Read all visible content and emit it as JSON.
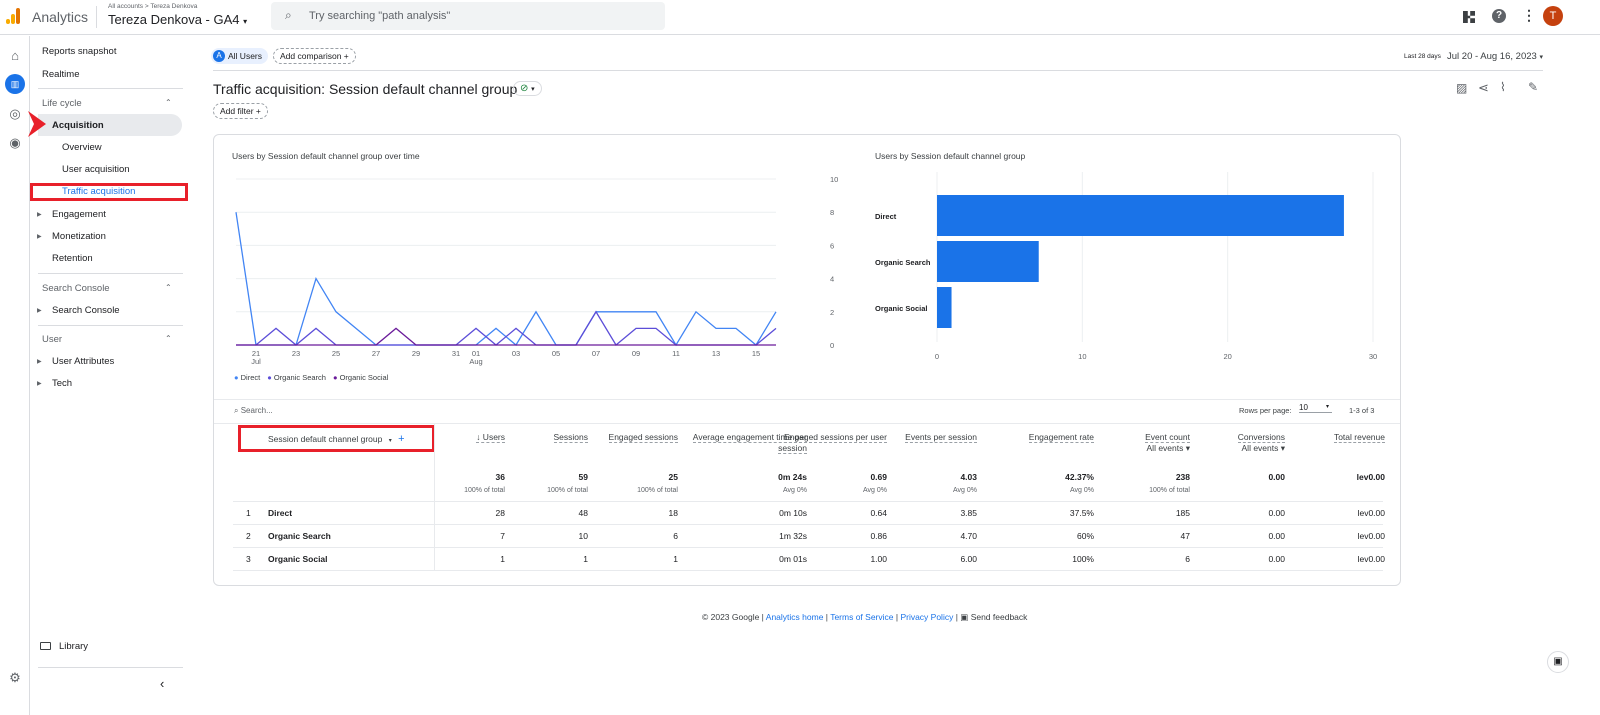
{
  "header": {
    "app": "Analytics",
    "breadcrumb": "All accounts > Tereza Denkova",
    "property": "Tereza Denkova - GA4",
    "search_placeholder": "Try searching \"path analysis\"",
    "avatar": "T"
  },
  "colors": {
    "accent": "#1a73e8",
    "direct": "#4285f4",
    "organic_search": "#5c4ed8",
    "organic_social": "#6a1b9a",
    "annotation": "#e8202a"
  },
  "sidebar": {
    "items": [
      "Reports snapshot",
      "Realtime"
    ],
    "lifecycle": "Life cycle",
    "acquisition": "Acquisition",
    "acq_sub": [
      "Overview",
      "User acquisition",
      "Traffic acquisition"
    ],
    "lifecycle_items": [
      "Engagement",
      "Monetization",
      "Retention"
    ],
    "search_console": "Search Console",
    "sc_items": [
      "Search Console"
    ],
    "user": "User",
    "user_items": [
      "User Attributes",
      "Tech"
    ],
    "library": "Library"
  },
  "filters": {
    "segment_badge": "A",
    "segment": "All Users",
    "add_comparison": "Add comparison",
    "date_label": "Last 28 days",
    "date_range": "Jul 20 - Aug 16, 2023",
    "add_filter": "Add filter"
  },
  "page_title": "Traffic acquisition: Session default channel group",
  "chart_data": [
    {
      "type": "line",
      "title": "Users by Session default channel group over time",
      "x": [
        "Jul 20",
        "Jul 21",
        "Jul 22",
        "Jul 23",
        "Jul 24",
        "Jul 25",
        "Jul 26",
        "Jul 27",
        "Jul 28",
        "Jul 29",
        "Jul 30",
        "Jul 31",
        "Aug 01",
        "Aug 02",
        "Aug 03",
        "Aug 04",
        "Aug 05",
        "Aug 06",
        "Aug 07",
        "Aug 08",
        "Aug 09",
        "Aug 10",
        "Aug 11",
        "Aug 12",
        "Aug 13",
        "Aug 14",
        "Aug 15",
        "Aug 16"
      ],
      "x_tick_labels": [
        "21",
        "23",
        "25",
        "27",
        "29",
        "31",
        "01",
        "03",
        "05",
        "07",
        "09",
        "11",
        "13",
        "15"
      ],
      "x_tick_sublabels": {
        "21": "Jul",
        "01": "Aug"
      },
      "y_ticks": [
        "10",
        "8",
        "6",
        "4",
        "2",
        "0"
      ],
      "ylim": [
        0,
        10
      ],
      "grid": true,
      "legend": "bottom-left",
      "series": [
        {
          "name": "Direct",
          "values": [
            8,
            0,
            0,
            0,
            4,
            2,
            1,
            0,
            0,
            0,
            0,
            0,
            0,
            1,
            0,
            2,
            0,
            0,
            2,
            2,
            2,
            2,
            0,
            2,
            1,
            1,
            0,
            2
          ]
        },
        {
          "name": "Organic Search",
          "values": [
            0,
            0,
            1,
            0,
            1,
            0,
            0,
            0,
            0,
            0,
            0,
            0,
            1,
            0,
            1,
            0,
            0,
            0,
            2,
            0,
            1,
            1,
            0,
            0,
            0,
            0,
            0,
            1
          ]
        },
        {
          "name": "Organic Social",
          "values": [
            0,
            0,
            0,
            0,
            0,
            0,
            0,
            0,
            1,
            0,
            0,
            0,
            0,
            0,
            0,
            0,
            0,
            0,
            0,
            0,
            0,
            0,
            0,
            0,
            0,
            0,
            0,
            0
          ]
        }
      ]
    },
    {
      "type": "bar",
      "orientation": "horizontal",
      "title": "Users by Session default channel group",
      "categories": [
        "Direct",
        "Organic Search",
        "Organic Social"
      ],
      "values": [
        28,
        7,
        1
      ],
      "x_ticks": [
        "0",
        "10",
        "20",
        "30"
      ],
      "xlim": [
        0,
        30
      ],
      "grid": true
    }
  ],
  "table": {
    "search_placeholder": "Search...",
    "rows_per_page_label": "Rows per page:",
    "rows_per_page": "10",
    "pagination": "1-3 of 3",
    "dimension_header": "Session default channel group",
    "columns": [
      {
        "label": "↓ Users"
      },
      {
        "label": "Sessions"
      },
      {
        "label": "Engaged sessions"
      },
      {
        "label": "Average engagement time per session"
      },
      {
        "label": "Engaged sessions per user"
      },
      {
        "label": "Events per session"
      },
      {
        "label": "Engagement rate"
      },
      {
        "label": "Event count",
        "sub": "All events"
      },
      {
        "label": "Conversions",
        "sub": "All events"
      },
      {
        "label": "Total revenue"
      }
    ],
    "totals": [
      "36",
      "59",
      "25",
      "0m 24s",
      "0.69",
      "4.03",
      "42.37%",
      "238",
      "0.00",
      "lev0.00"
    ],
    "totals_sub": [
      "100% of total",
      "100% of total",
      "100% of total",
      "Avg 0%",
      "Avg 0%",
      "Avg 0%",
      "Avg 0%",
      "100% of total",
      "",
      ""
    ],
    "rows": [
      {
        "n": "1",
        "name": "Direct",
        "values": [
          "28",
          "48",
          "18",
          "0m 10s",
          "0.64",
          "3.85",
          "37.5%",
          "185",
          "0.00",
          "lev0.00"
        ]
      },
      {
        "n": "2",
        "name": "Organic Search",
        "values": [
          "7",
          "10",
          "6",
          "1m 32s",
          "0.86",
          "4.70",
          "60%",
          "47",
          "0.00",
          "lev0.00"
        ]
      },
      {
        "n": "3",
        "name": "Organic Social",
        "values": [
          "1",
          "1",
          "1",
          "0m 01s",
          "1.00",
          "6.00",
          "100%",
          "6",
          "0.00",
          "lev0.00"
        ]
      }
    ]
  },
  "footer": {
    "copyright": "© 2023 Google |",
    "links": [
      "Analytics home",
      "Terms of Service",
      "Privacy Policy"
    ],
    "feedback": "Send feedback"
  }
}
